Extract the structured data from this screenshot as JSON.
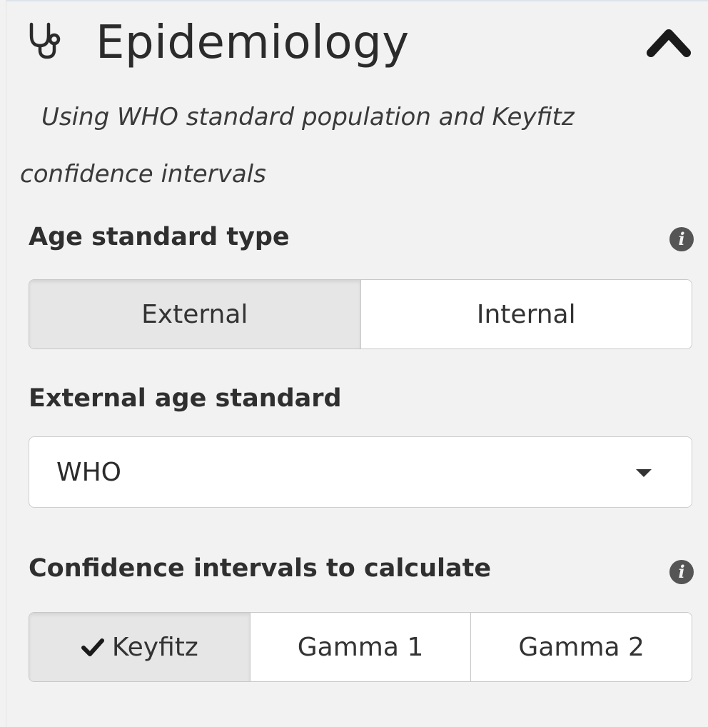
{
  "panel": {
    "title": "Epidemiology",
    "title_icon": "stethoscope-icon",
    "collapse_icon": "chevron-up-icon",
    "subtitle": "Using WHO standard population and Keyfitz confidence intervals"
  },
  "age_standard_type": {
    "label": "Age standard type",
    "info_icon": "info-circle-icon",
    "options": [
      "External",
      "Internal"
    ],
    "selected": "External"
  },
  "external_age_standard": {
    "label": "External age standard",
    "value": "WHO",
    "dropdown_icon": "caret-down-icon"
  },
  "confidence_intervals": {
    "label": "Confidence intervals to calculate",
    "info_icon": "info-circle-icon",
    "options": [
      "Keyfitz",
      "Gamma 1",
      "Gamma 2"
    ],
    "selected": [
      "Keyfitz"
    ],
    "selected_icon": "check-icon"
  },
  "colors": {
    "background": "#f2f2f2",
    "active_button": "#e6e6e6",
    "inactive_button": "#ffffff",
    "text": "#2b2b2b"
  }
}
